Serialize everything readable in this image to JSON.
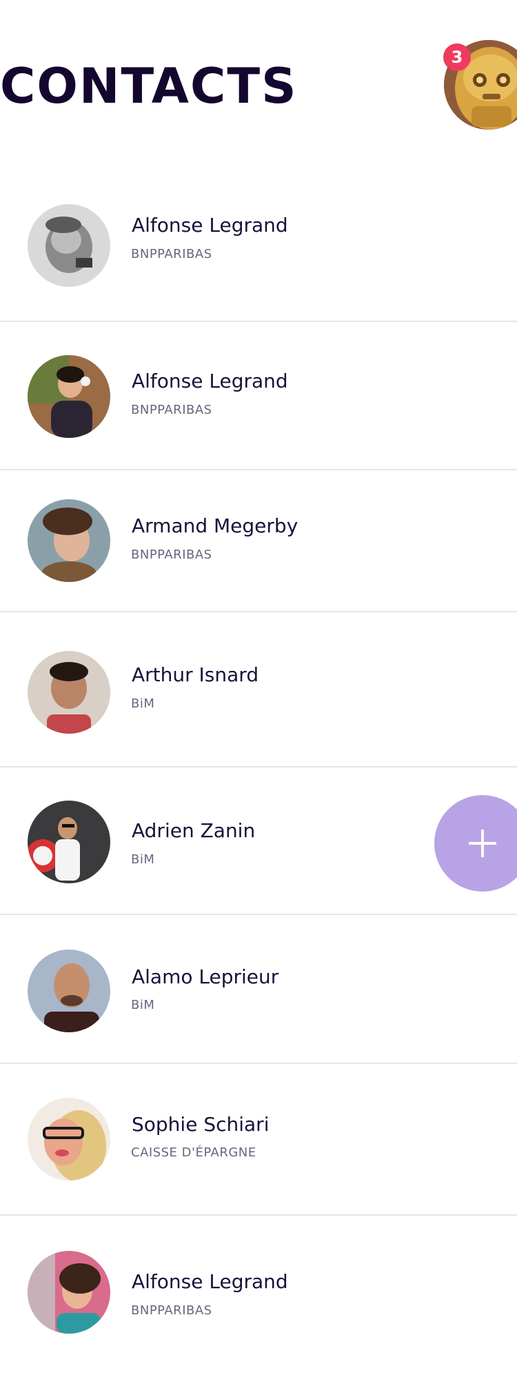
{
  "header": {
    "title": "CONTACTS",
    "profile_avatar_icon": "user-avatar-robot",
    "notification_count": "3"
  },
  "contacts": [
    {
      "name": "Alfonse Legrand",
      "company": "BNPPARIBAS"
    },
    {
      "name": "Alfonse Legrand",
      "company": "BNPPARIBAS"
    },
    {
      "name": "Armand Megerby",
      "company": "BNPPARIBAS"
    },
    {
      "name": "Arthur Isnard",
      "company": "BiM"
    },
    {
      "name": "Adrien Zanin",
      "company": "BiM"
    },
    {
      "name": "Alamo Leprieur",
      "company": "BiM"
    },
    {
      "name": "Sophie Schiari",
      "company": "CAISSE D'ÉPARGNE"
    },
    {
      "name": "Alfonse Legrand",
      "company": "BNPPARIBAS"
    }
  ],
  "fab": {
    "icon": "plus-icon"
  },
  "colors": {
    "title": "#14062e",
    "badge": "#f03a5f",
    "fab": "#b8a3e6",
    "divider": "#e6e6e6"
  }
}
